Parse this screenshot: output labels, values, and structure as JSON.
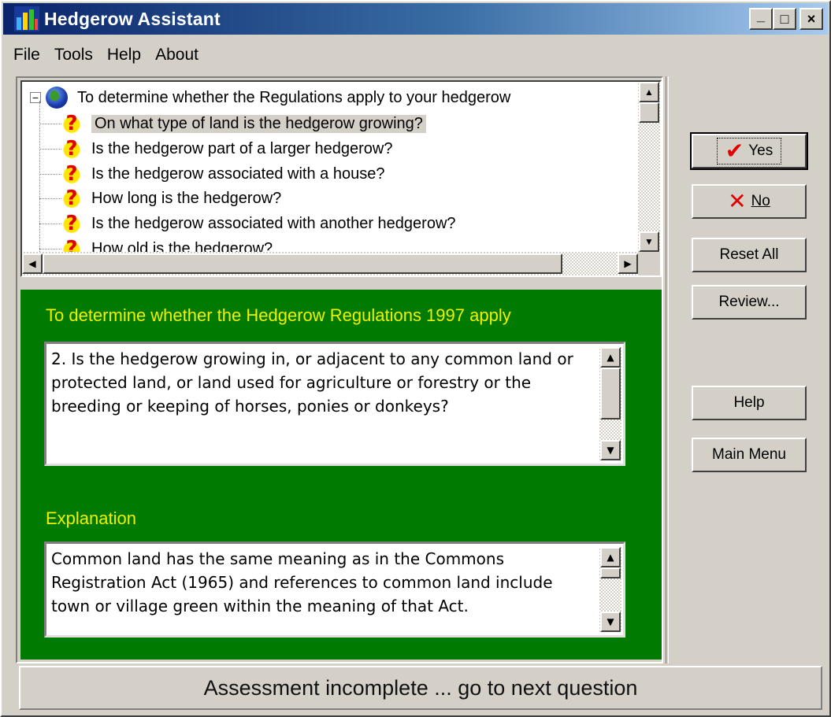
{
  "window": {
    "title": "Hedgerow Assistant"
  },
  "titlebar_buttons": {
    "minimize": "_",
    "maximize": "□",
    "close": "×"
  },
  "menu": {
    "file": "File",
    "tools": "Tools",
    "help": "Help",
    "about": "About"
  },
  "tree": {
    "root": "To determine whether the Regulations apply to your hedgerow",
    "root_expander": "−",
    "items": [
      {
        "label": "On what type of land is the hedgerow growing?",
        "selected": true
      },
      {
        "label": "Is the hedgerow part of a larger hedgerow?"
      },
      {
        "label": "Is the hedgerow associated with a house?"
      },
      {
        "label": "How long is the hedgerow?"
      },
      {
        "label": "Is the hedgerow associated with another hedgerow?"
      },
      {
        "label": "How old is the hedgerow?"
      }
    ]
  },
  "question_panel": {
    "heading": "To determine whether the Hedgerow Regulations 1997 apply",
    "question": "2. Is the hedgerow growing in, or adjacent to any common land or protected land, or land used for agriculture or forestry or the breeding or keeping of horses, ponies or donkeys?",
    "explanation_heading": "Explanation",
    "explanation": "Common land has the same meaning as in the Commons Registration Act (1965) and references to common land include town or village green within the meaning of that Act."
  },
  "buttons": {
    "yes": "Yes",
    "no": "No",
    "reset_all": "Reset All",
    "review": "Review...",
    "help": "Help",
    "main_menu": "Main Menu"
  },
  "status": "Assessment incomplete ... go to next question",
  "colors": {
    "panel_green": "#007a00",
    "heading_yellow": "#f0f000",
    "title_blue": "#0a246a"
  }
}
